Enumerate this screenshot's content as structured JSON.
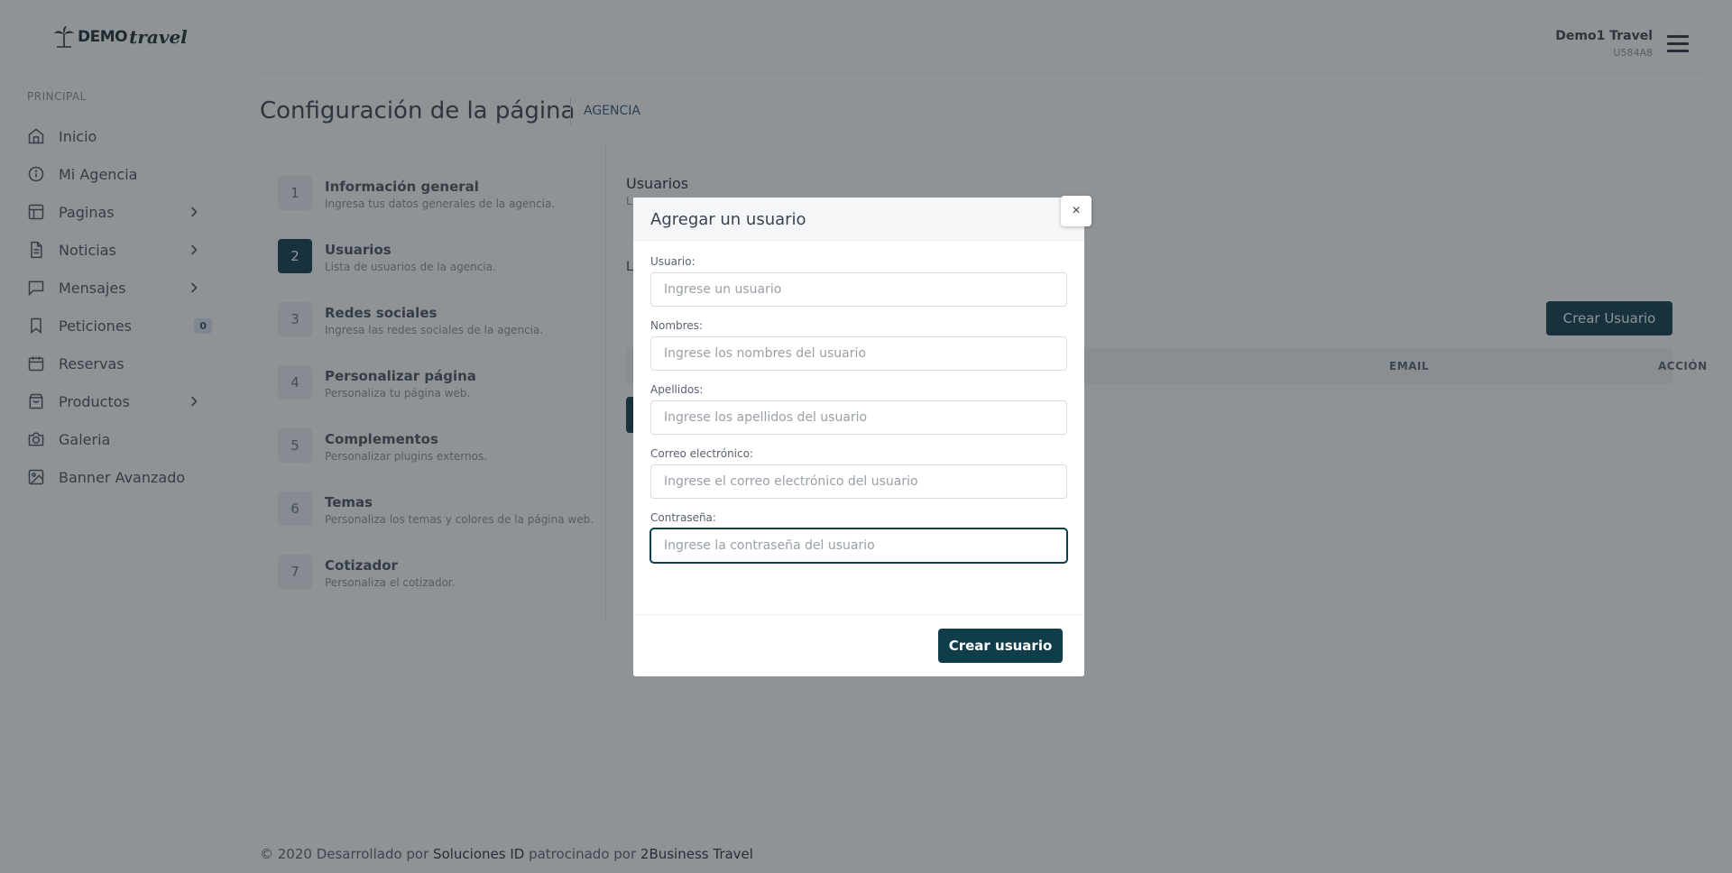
{
  "brand": {
    "demo": "DEMO",
    "travel": "travel"
  },
  "sidebar": {
    "section": "PRINCIPAL",
    "items": [
      {
        "label": "Inicio",
        "icon": "home-icon"
      },
      {
        "label": "Mi Agencia",
        "icon": "info-icon"
      },
      {
        "label": "Paginas",
        "icon": "layout-icon",
        "chevron": true
      },
      {
        "label": "Noticias",
        "icon": "file-icon",
        "chevron": true
      },
      {
        "label": "Mensajes",
        "icon": "message-icon",
        "chevron": true
      },
      {
        "label": "Peticiones",
        "icon": "bookmark-icon",
        "badge": "0"
      },
      {
        "label": "Reservas",
        "icon": "calendar-icon"
      },
      {
        "label": "Productos",
        "icon": "shopping-bag-icon",
        "chevron": true
      },
      {
        "label": "Galeria",
        "icon": "camera-icon"
      },
      {
        "label": "Banner Avanzado",
        "icon": "image-icon"
      }
    ]
  },
  "topbar": {
    "user_name": "Demo1 Travel",
    "user_code": "U584A8"
  },
  "page": {
    "title": "Configuración de la página",
    "crumb": "AGENCIA"
  },
  "steps": [
    {
      "num": "1",
      "title": "Información general",
      "desc": "Ingresa tus datos generales de la agencia."
    },
    {
      "num": "2",
      "title": "Usuarios",
      "desc": "Lista de usuarios de la agencia."
    },
    {
      "num": "3",
      "title": "Redes sociales",
      "desc": "Ingresa las redes sociales de la agencia."
    },
    {
      "num": "4",
      "title": "Personalizar página",
      "desc": "Personaliza tu página web."
    },
    {
      "num": "5",
      "title": "Complementos",
      "desc": "Personalizar plugins externos."
    },
    {
      "num": "6",
      "title": "Temas",
      "desc": "Personaliza los temas y colores de la página web."
    },
    {
      "num": "7",
      "title": "Cotizador",
      "desc": "Personaliza el cotizador."
    }
  ],
  "panel": {
    "title": "Usuarios",
    "subtitle": "L",
    "letter": "L",
    "create_button": "Crear Usuario",
    "table_headers": [
      "EMAIL",
      "ACCIÓN"
    ]
  },
  "footer": {
    "prefix": "© 2020 Desarrollado por ",
    "company": "Soluciones ID",
    "middle": " patrocinado por ",
    "sponsor": "2Business Travel"
  },
  "modal": {
    "title": "Agregar un usuario",
    "close": "×",
    "fields": [
      {
        "label": "Usuario:",
        "placeholder": "Ingrese un usuario"
      },
      {
        "label": "Nombres:",
        "placeholder": "Ingrese los nombres del usuario"
      },
      {
        "label": "Apellidos:",
        "placeholder": "Ingrese los apellidos del usuario"
      },
      {
        "label": "Correo electrónico:",
        "placeholder": "Ingrese el correo electrónico del usuario"
      },
      {
        "label": "Contraseña:",
        "placeholder": "Ingrese la contraseña del usuario"
      }
    ],
    "submit": "Crear usuario"
  },
  "colors": {
    "primary": "#0f3d4a",
    "overlay": "rgba(32,40,45,0.5)"
  }
}
